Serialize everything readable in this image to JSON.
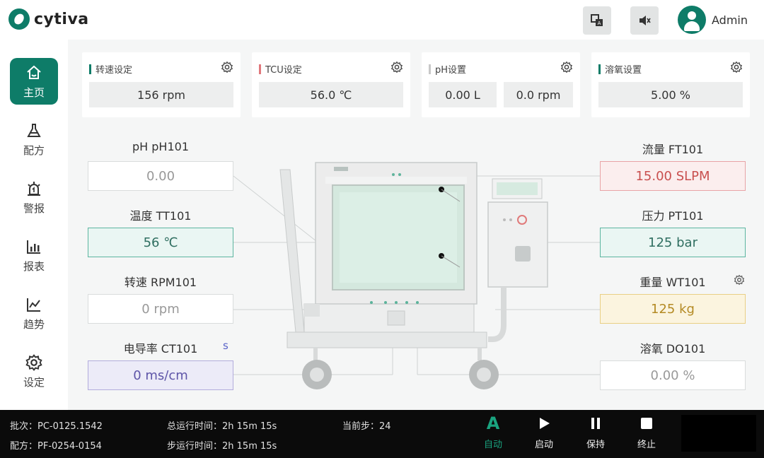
{
  "header": {
    "brand": "cytiva",
    "user_name": "Admin",
    "icons": [
      "translate-icon",
      "sound-icon",
      "user-avatar-icon"
    ]
  },
  "sidebar": {
    "items": [
      {
        "label": "主页",
        "icon": "home-icon",
        "active": true
      },
      {
        "label": "配方",
        "icon": "flask-icon",
        "active": false
      },
      {
        "label": "警报",
        "icon": "alarm-icon",
        "active": false
      },
      {
        "label": "报表",
        "icon": "bar-chart-icon",
        "active": false
      },
      {
        "label": "趋势",
        "icon": "trend-icon",
        "active": false
      },
      {
        "label": "设定",
        "icon": "gear-icon",
        "active": false
      }
    ]
  },
  "setpoints": {
    "speed": {
      "title": "转速设定",
      "value": "156 rpm",
      "accent": "#0e7c68"
    },
    "tcu": {
      "title": "TCU设定",
      "value": "56.0 ℃",
      "accent": "#e0787c"
    },
    "ph": {
      "title": "pH设置",
      "value_left": "0.00 L",
      "value_right": "0.0 rpm",
      "accent": "#c8c8c8"
    },
    "do": {
      "title": "溶氧设置",
      "value": "5.00 %",
      "accent": "#0e7c68"
    }
  },
  "sensors": {
    "ph": {
      "label": "pH pH101",
      "value": "0.00"
    },
    "temp": {
      "label": "温度 TT101",
      "value": "56 ℃"
    },
    "rpm": {
      "label": "转速 RPM101",
      "value": "0 rpm"
    },
    "ct": {
      "label": "电导率 CT101",
      "value": "0 ms/cm",
      "link": "s"
    },
    "flow": {
      "label": "流量 FT101",
      "value": "15.00 SLPM"
    },
    "pressure": {
      "label": "压力 PT101",
      "value": "125 bar"
    },
    "weight": {
      "label": "重量 WT101",
      "value": "125 kg"
    },
    "do": {
      "label": "溶氧 DO101",
      "value": "0.00 %"
    }
  },
  "statusbar": {
    "batch_label": "批次：",
    "batch_value": "PC-0125.1542",
    "recipe_label": "配方：",
    "recipe_value": "PF-0254-0154",
    "total_label": "总运行时间：",
    "total_value": "2h 15m 15s",
    "step_label": "步运行时间：",
    "step_value": "2h 15m 15s",
    "current_step_label": "当前步：",
    "current_step_value": "24"
  },
  "controls": {
    "auto": {
      "glyph": "A",
      "label": "自动",
      "color": "#1aa37f"
    },
    "start": {
      "label": "启动"
    },
    "hold": {
      "label": "保持"
    },
    "stop": {
      "label": "终止"
    }
  }
}
